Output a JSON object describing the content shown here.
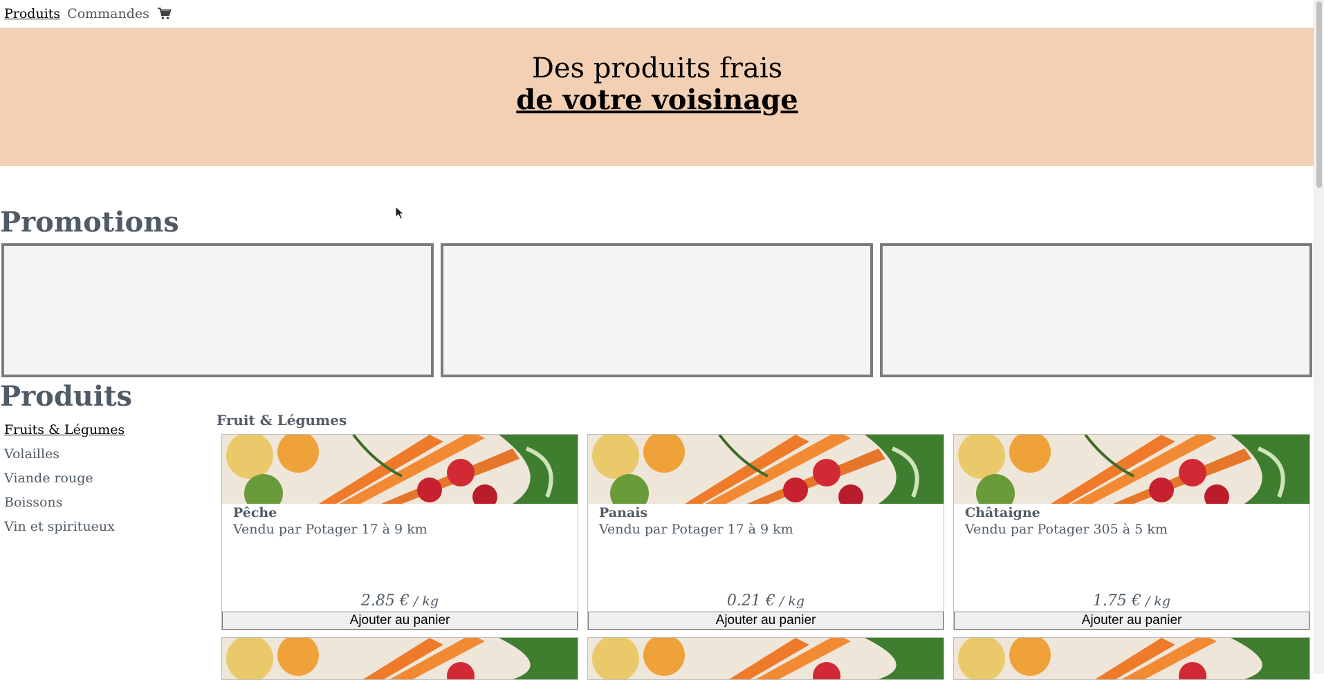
{
  "nav": {
    "products_label": "Produits",
    "orders_label": "Commandes",
    "cart_icon": "shopping-cart-icon"
  },
  "hero": {
    "line1": "Des produits frais",
    "line2": "de votre voisinage"
  },
  "promotions": {
    "title": "Promotions",
    "boxes": 3
  },
  "products": {
    "title": "Produits",
    "categories": [
      {
        "label": "Fruits & Légumes",
        "active": true
      },
      {
        "label": "Volailles",
        "active": false
      },
      {
        "label": "Viande rouge",
        "active": false
      },
      {
        "label": "Boissons",
        "active": false
      },
      {
        "label": "Vin et spiritueux",
        "active": false
      }
    ],
    "section_label": "Fruit & Légumes",
    "items": [
      {
        "name": "Pêche",
        "seller": "Vendu par Potager 17 à 9 km",
        "price": "2.85 €",
        "unit": " / kg",
        "button": "Ajouter au panier"
      },
      {
        "name": "Panais",
        "seller": "Vendu par Potager 17 à 9 km",
        "price": "0.21 €",
        "unit": " / kg",
        "button": "Ajouter au panier"
      },
      {
        "name": "Châtaigne",
        "seller": "Vendu par Potager 305 à 5 km",
        "price": "1.75 €",
        "unit": " / kg",
        "button": "Ajouter au panier"
      }
    ]
  },
  "colors": {
    "hero_bg": "#f3d0b3",
    "heading": "#4f5b66",
    "promo_border": "#7b7b7b"
  }
}
